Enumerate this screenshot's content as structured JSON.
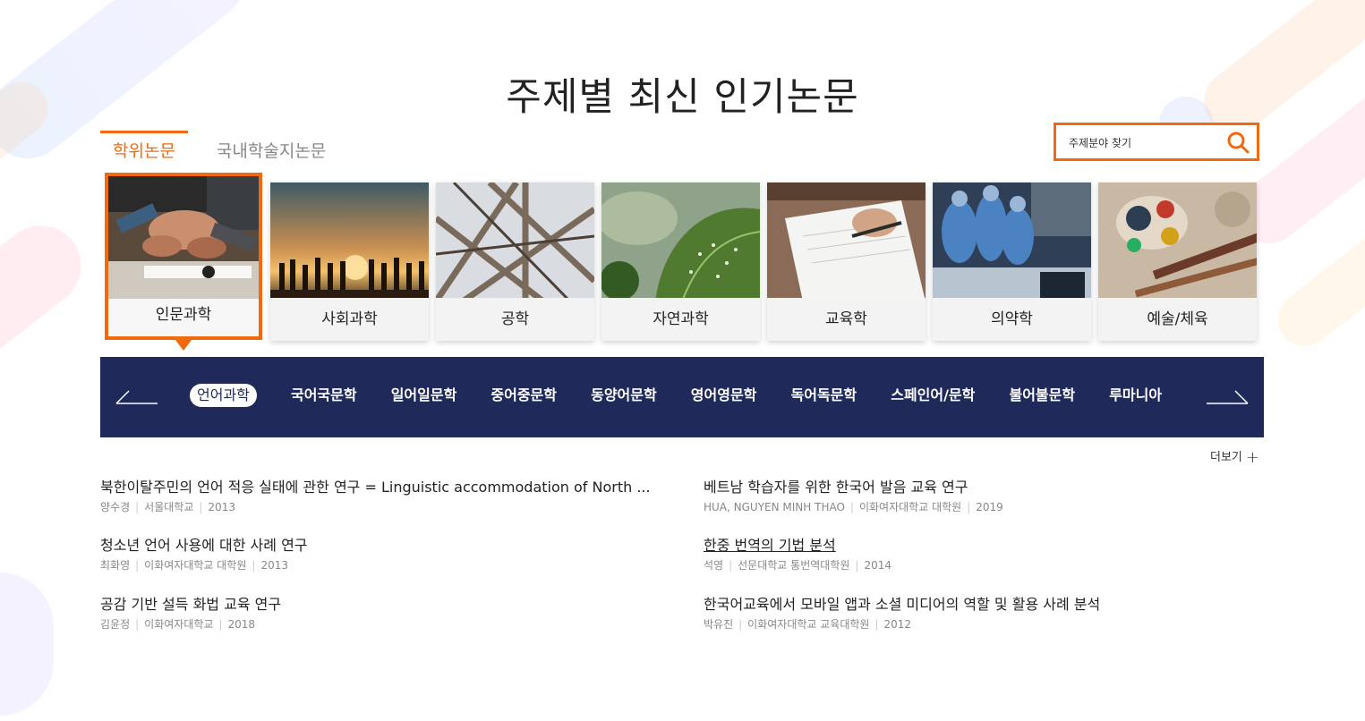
{
  "header": {
    "title": "주제별 최신 인기논문"
  },
  "tabs": [
    {
      "label": "학위논문",
      "active": true
    },
    {
      "label": "국내학술지논문",
      "active": false
    }
  ],
  "search": {
    "placeholder": "주제분야 찾기"
  },
  "categories": [
    {
      "label": "인문과학",
      "active": true
    },
    {
      "label": "사회과학"
    },
    {
      "label": "공학"
    },
    {
      "label": "자연과학"
    },
    {
      "label": "교육학"
    },
    {
      "label": "의약학"
    },
    {
      "label": "예술/체육"
    }
  ],
  "subnav": {
    "items": [
      "언어과학",
      "국어국문학",
      "일어일문학",
      "중어중문학",
      "동양어문학",
      "영어영문학",
      "독어독문학",
      "스페인어/문학",
      "불어불문학",
      "루마니아"
    ],
    "active_index": 0
  },
  "more": {
    "label": "더보기"
  },
  "papers_left": [
    {
      "title": "북한이탈주민의 언어 적응 실태에 관한 연구 = Linguistic accommodation of North ...",
      "author": "양수경",
      "institution": "서울대학교",
      "year": "2013"
    },
    {
      "title": "청소년 언어 사용에 대한 사례 연구",
      "author": "최화영",
      "institution": "이화여자대학교 대학원",
      "year": "2013"
    },
    {
      "title": "공감 기반 설득 화법 교육 연구",
      "author": "김윤정",
      "institution": "이화여자대학교",
      "year": "2018"
    }
  ],
  "papers_right": [
    {
      "title": "베트남 학습자를 위한 한국어 발음 교육 연구",
      "author": "HUA, NGUYEN MINH THAO",
      "institution": "이화여자대학교 대학원",
      "year": "2019"
    },
    {
      "title": "한중 번역의 기법 분석",
      "author": "석영",
      "institution": "선문대학교 통번역대학원",
      "year": "2014"
    },
    {
      "title": "한국어교육에서 모바일 앱과 소셜 미디어의 역할 및 활용 사례 분석",
      "author": "박유진",
      "institution": "이화여자대학교 교육대학원",
      "year": "2012"
    }
  ],
  "colors": {
    "accent": "#f06a0f",
    "navy": "#1f2a5b"
  }
}
